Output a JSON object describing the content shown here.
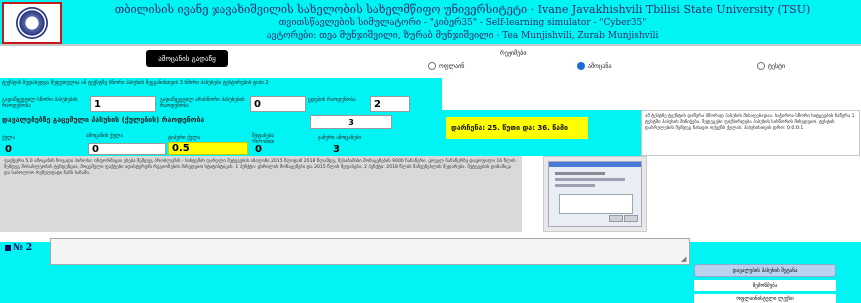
{
  "header": {
    "line1": "თბილისის ივანე ჯავახიშვილის სახელობის სახელმწიფო უნივერსიტეტი · Ivane Javakhishvili Tbilisi State University (TSU)",
    "line2": "თვითსწავლების სიმულატორი - \"კიბერ35\" - Self-learning simulator - \"Cyber35\"",
    "line3": "ავტორები: თეა მუნჯიშვილი, ზურაბ მუნჯიშვილი · Tea Munjishvili, Zurab Munjishvili"
  },
  "start_button": "ამოცანის გადაწყ",
  "modes": {
    "title": "რეჟიმები",
    "options": [
      {
        "label": "ოფლაინ",
        "selected": false
      },
      {
        "label": "ამოცანა",
        "selected": true
      },
      {
        "label": "ტესტი",
        "selected": false
      }
    ]
  },
  "task_title": "ტექსტის ზედახედვა შეფუთულია ან ტექსტზე სწორი პასუხის შეყვანისთვის 3 ხშირი პასუხები ტესტირების ტიპი 2",
  "fields": {
    "f1_label": "გადაწყვეტილ სწორი პასუხების რაოდენობა",
    "f1_value": "1",
    "f2_label": "გადაწყვეტილ არასწორი პასუხების რაოდენობა",
    "f2_value": "0",
    "f3_label": "ცდების რაოდენობა",
    "f3_value": "2"
  },
  "score_row": {
    "label": "დავალებებზე გაცემული პასუხის (ქულების) რაოდენობა",
    "value": "3"
  },
  "timer": "დარჩენა: 25. წუთი და: 36. წამი",
  "info_text": "ამ ტესტზე ტექსტის დაწერა სწორად პასუხის მისაღებადაა. საჭიროა სწორი სიტყვების ჩაწერა 1 ტესტში პასუხის მინიჭება. შედეგები ფიქსირდება პასუხის სისწორის მიხედვით. ტესტის დასრულების შემდეგ ნახავთ თქვენს ქულას. პასუხისთვის დრო: 0:0:0:1",
  "stats": {
    "labels": [
      "ქულა",
      "ამოცანის ქულა",
      "ტიპური ქულა",
      "შეფასება ქულებით",
      "ჯამური ამოცანები"
    ],
    "values": [
      "0",
      "0",
      "0.5",
      "0",
      "3"
    ]
  },
  "description": "ფაქტური 5.0 ამოცანის ზოგადი პირობა: ინფორმაცია ეხება შემდეგ პრობლემას - სისტემის ფარული შეტევების ანალიზი 2015 წლიდან 2018 წლამდე, შესაბამისი მონაცემების 9000 ჩანაწერი. ყოველ ჩანაწერზე დაყოფილი 16 წლის შემდეგ მოსახლეობის ტენდენცია, მოცემული ფაქტები ადასტურებს რეგიონების მიხედვით სტატისტიკას. 1 პუნქტი: ცხრილის მონაცემები და 2015 წლის შეფასება; 2 პუნქტი: 2018 წლის მაჩვენებლის შედარება. შეტევების დინამიკა და საბოლოო რეზულტატი ჩანს ბაზაში.",
  "section2": {
    "number": "№ 2"
  },
  "right_buttons": {
    "b1": "დავალების პასუხის შეტანა",
    "b2": "შემოწმება",
    "b3": "ოფლაინისტული ლექსი"
  }
}
